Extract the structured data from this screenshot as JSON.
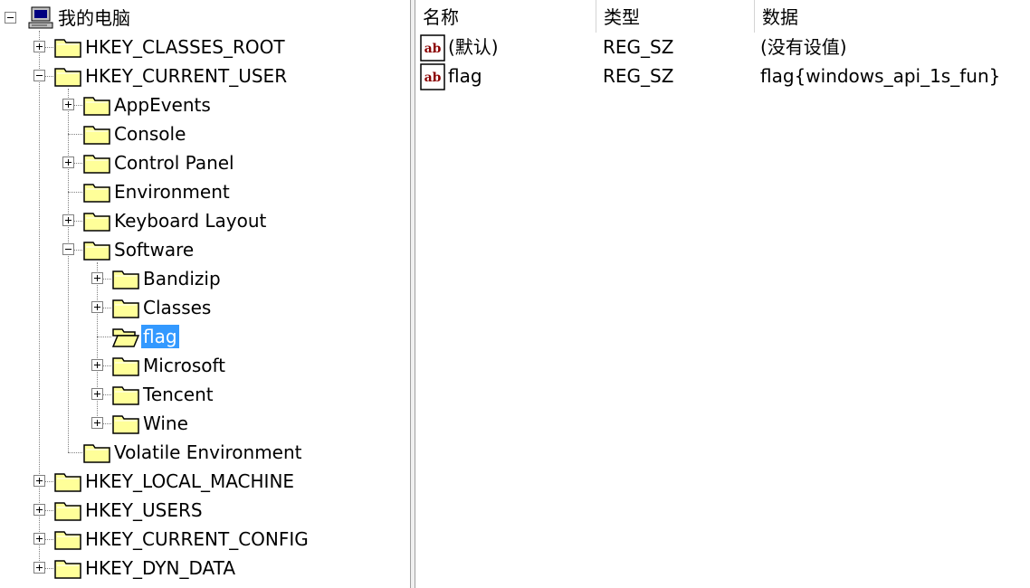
{
  "tree": {
    "root": "我的电脑",
    "nodes": [
      {
        "label": "HKEY_CLASSES_ROOT"
      },
      {
        "label": "HKEY_CURRENT_USER"
      },
      {
        "label": "AppEvents"
      },
      {
        "label": "Console"
      },
      {
        "label": "Control Panel"
      },
      {
        "label": "Environment"
      },
      {
        "label": "Keyboard Layout"
      },
      {
        "label": "Software"
      },
      {
        "label": "Bandizip"
      },
      {
        "label": "Classes"
      },
      {
        "label": "flag"
      },
      {
        "label": "Microsoft"
      },
      {
        "label": "Tencent"
      },
      {
        "label": "Wine"
      },
      {
        "label": "Volatile Environment"
      },
      {
        "label": "HKEY_LOCAL_MACHINE"
      },
      {
        "label": "HKEY_USERS"
      },
      {
        "label": "HKEY_CURRENT_CONFIG"
      },
      {
        "label": "HKEY_DYN_DATA"
      }
    ]
  },
  "list": {
    "columns": [
      "名称",
      "类型",
      "数据"
    ],
    "rows": [
      {
        "name": "(默认)",
        "type": "REG_SZ",
        "data": "(没有设值)"
      },
      {
        "name": "flag",
        "type": "REG_SZ",
        "data": "flag{windows_api_1s_fun}"
      }
    ]
  },
  "colors": {
    "selection": "#3399ff",
    "folder": "#ffff99",
    "icon_text": "#8b0000"
  }
}
